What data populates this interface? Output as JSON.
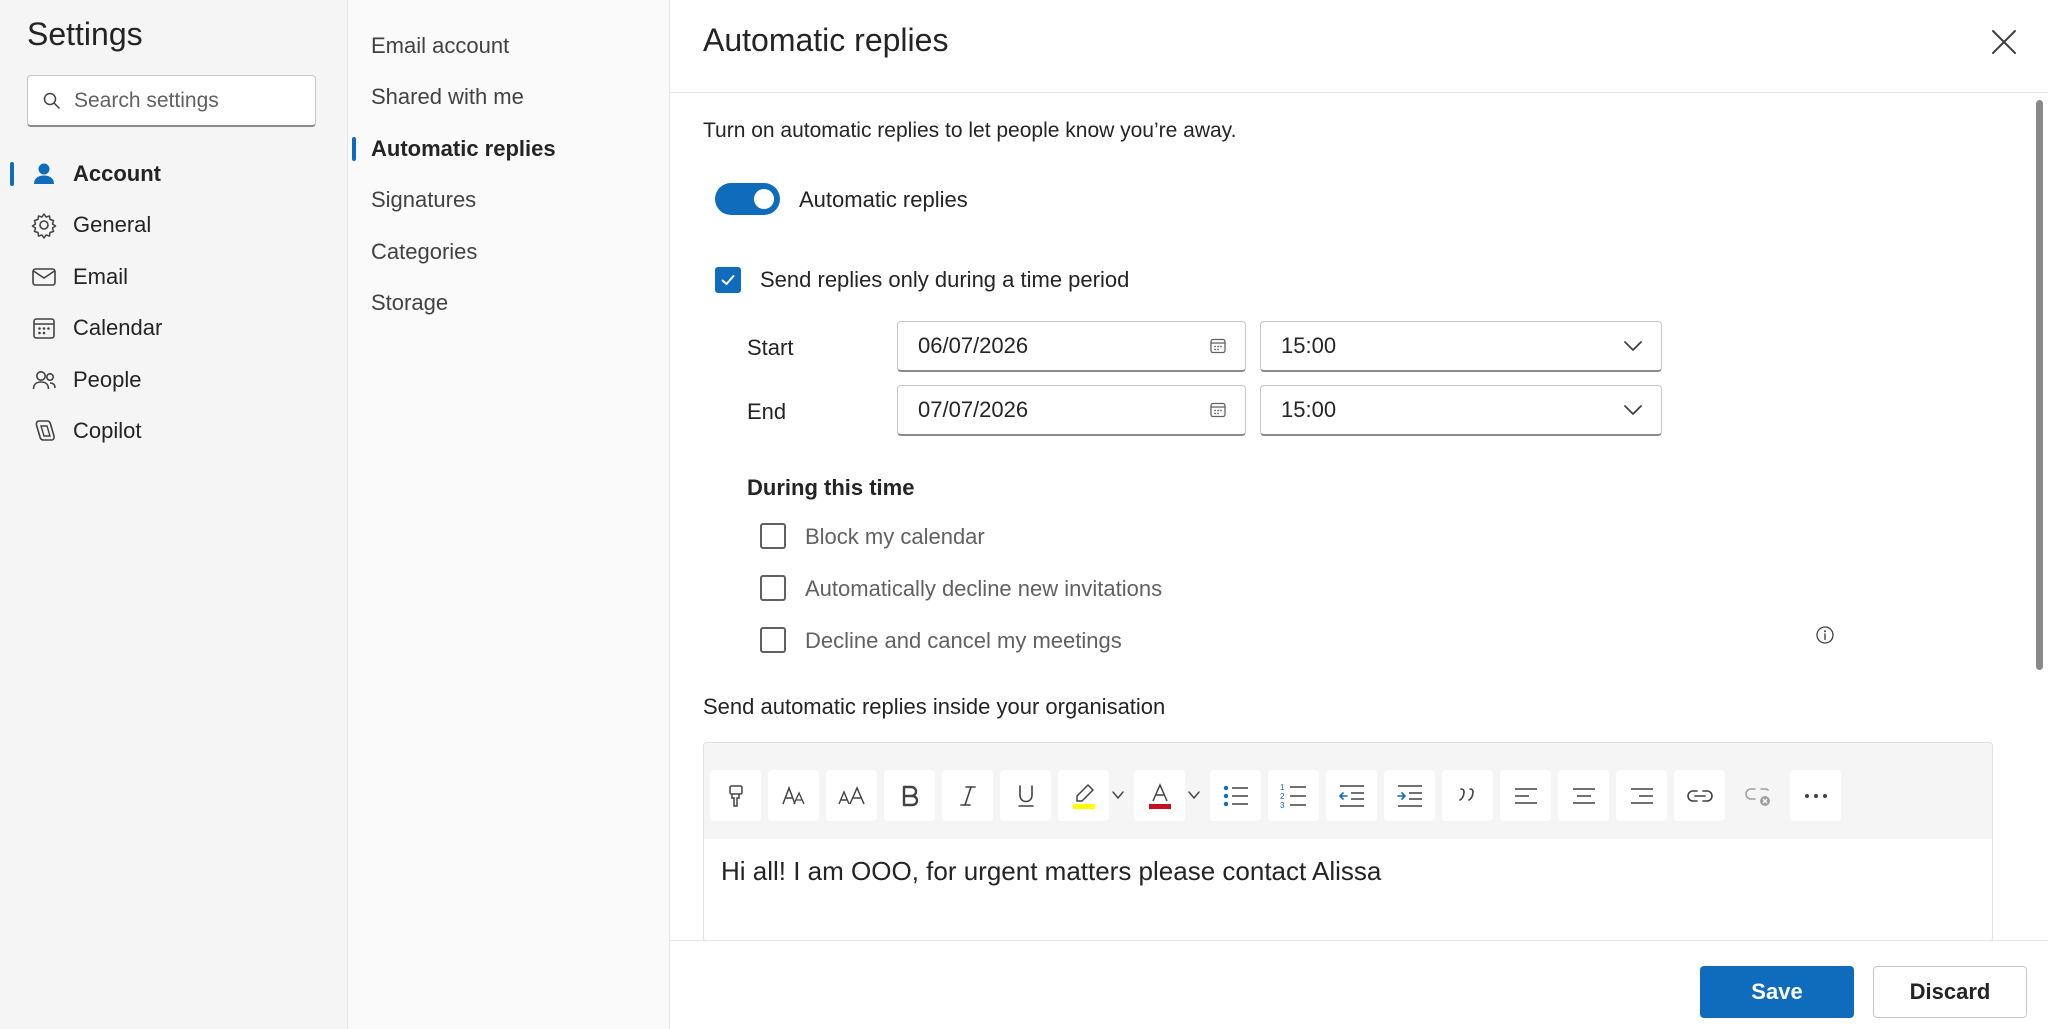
{
  "settings": {
    "title": "Settings",
    "search_placeholder": "Search settings"
  },
  "nav": {
    "items": [
      {
        "label": "Account",
        "icon": "person-icon",
        "active": true
      },
      {
        "label": "General",
        "icon": "gear-icon"
      },
      {
        "label": "Email",
        "icon": "mail-icon"
      },
      {
        "label": "Calendar",
        "icon": "calendar-icon"
      },
      {
        "label": "People",
        "icon": "people-icon"
      },
      {
        "label": "Copilot",
        "icon": "copilot-icon"
      }
    ]
  },
  "subnav": {
    "items": [
      {
        "label": "Email account"
      },
      {
        "label": "Shared with me"
      },
      {
        "label": "Automatic replies",
        "active": true
      },
      {
        "label": "Signatures"
      },
      {
        "label": "Categories"
      },
      {
        "label": "Storage"
      }
    ]
  },
  "panel": {
    "title": "Automatic replies",
    "intro": "Turn on automatic replies to let people know you’re away.",
    "toggle_label": "Automatic replies",
    "toggle_on": true,
    "time_period_label": "Send replies only during a time period",
    "time_period_checked": true,
    "start_label": "Start",
    "start_date": "06/07/2026",
    "start_time": "15:00",
    "end_label": "End",
    "end_date": "07/07/2026",
    "end_time": "15:00",
    "during_heading": "During this time",
    "options": [
      {
        "label": "Block my calendar",
        "checked": false
      },
      {
        "label": "Automatically decline new invitations",
        "checked": false
      },
      {
        "label": "Decline and cancel my meetings",
        "checked": false
      }
    ],
    "org_label": "Send automatic replies inside your organisation",
    "message": "Hi all! I am OOO, for urgent matters please contact Alissa"
  },
  "footer": {
    "save_label": "Save",
    "discard_label": "Discard"
  },
  "colors": {
    "accent": "#0f6cbd",
    "highlight": "#ffff00",
    "font_color": "#c50f1f"
  }
}
